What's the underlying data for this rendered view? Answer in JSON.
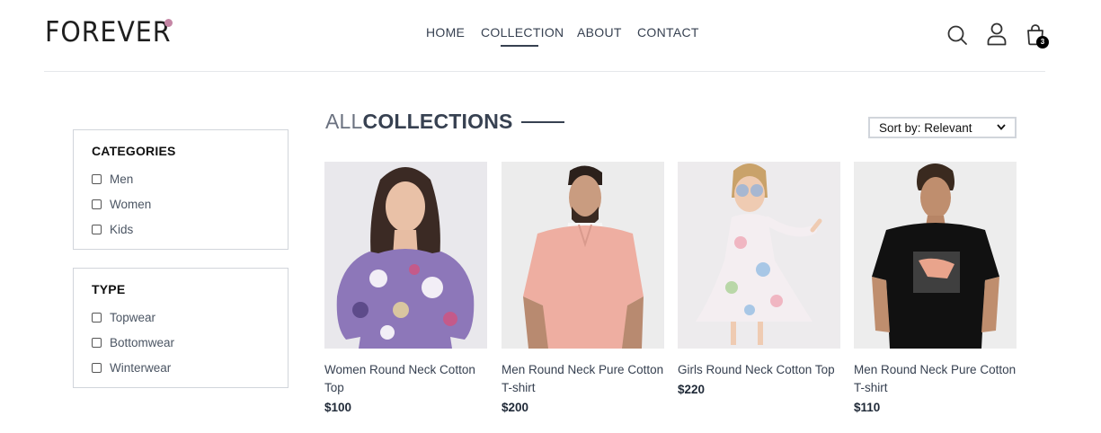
{
  "header": {
    "logo": "FOREVER",
    "nav": [
      {
        "label": "HOME"
      },
      {
        "label": "COLLECTION",
        "active": true
      },
      {
        "label": "ABOUT"
      },
      {
        "label": "CONTACT"
      }
    ],
    "cart_count": "3",
    "icons": [
      "search-icon",
      "profile-icon",
      "cart-icon"
    ]
  },
  "filters": {
    "categories": {
      "title": "CATEGORIES",
      "options": [
        "Men",
        "Women",
        "Kids"
      ]
    },
    "type": {
      "title": "TYPE",
      "options": [
        "Topwear",
        "Bottomwear",
        "Winterwear"
      ]
    }
  },
  "collection": {
    "title_light": "ALL",
    "title_bold": "COLLECTIONS",
    "sort_label": "Sort by: Relevant"
  },
  "products": [
    {
      "name": "Women Round Neck Cotton Top",
      "price": "$100"
    },
    {
      "name": "Men Round Neck Pure Cotton T-shirt",
      "price": "$200"
    },
    {
      "name": "Girls Round Neck Cotton Top",
      "price": "$220"
    },
    {
      "name": "Men Round Neck Pure Cotton T-shirt",
      "price": "$110"
    }
  ],
  "colors": {
    "accent_dot": "#c586a5",
    "text": "#374151",
    "border": "#d1d5db"
  }
}
